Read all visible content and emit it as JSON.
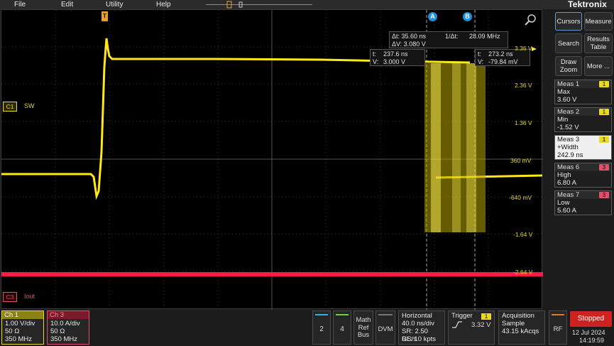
{
  "menu": {
    "items": [
      "File",
      "Edit",
      "Utility",
      "Help"
    ],
    "brand": "Tektronix"
  },
  "right_panel": {
    "buttons": [
      "Cursors",
      "Measure",
      "Search",
      "Results Table",
      "Draw Zoom",
      "More ..."
    ]
  },
  "measurements": [
    {
      "title": "Meas 1",
      "badge": "1",
      "badge_color": "#e8d82a",
      "lines": [
        "Max",
        "3.60 V"
      ],
      "active": false
    },
    {
      "title": "Meas 2",
      "badge": "1",
      "badge_color": "#e8d82a",
      "lines": [
        "Min",
        "-1.52 V"
      ],
      "active": false
    },
    {
      "title": "Meas 3",
      "badge": "1",
      "badge_color": "#e8d82a",
      "lines": [
        "+Width",
        "242.9 ns"
      ],
      "active": true
    },
    {
      "title": "Meas 6",
      "badge": "3",
      "badge_color": "#e0506a",
      "lines": [
        "High",
        "6.80 A"
      ],
      "active": false
    },
    {
      "title": "Meas 7",
      "badge": "3",
      "badge_color": "#e0506a",
      "lines": [
        "Low",
        "5.60 A"
      ],
      "active": false
    }
  ],
  "screen": {
    "trigger_marker": "T",
    "cursor_a_label": "A",
    "cursor_b_label": "B",
    "delta_readout": {
      "dt": "Δt: 35.60 ns",
      "inv_dt": "1/Δt:",
      "inv_dt_val": "28.09 MHz",
      "dv": "ΔV: 3.080 V"
    },
    "cursor_a_readout": {
      "t": "t:",
      "t_val": "237.6 ns",
      "v": "V:",
      "v_val": "3.000 V"
    },
    "cursor_b_readout": {
      "t": "t:",
      "t_val": "273.2 ns",
      "v": "V:",
      "v_val": "-79.84 mV"
    },
    "level_labels": [
      "3.36 V",
      "2.36 V",
      "1.36 V",
      "360 mV",
      "-640 mV",
      "-1.64 V",
      "-2.64 V"
    ],
    "ch1_tag": "C1",
    "ch1_name": "SW",
    "ch3_tag": "C3",
    "ch3_name": "Iout"
  },
  "bottom": {
    "ch1": {
      "title": "Ch 1",
      "lines": [
        "1.00 V/div",
        "50 Ω",
        "350 MHz"
      ],
      "color": "#e8d82a"
    },
    "ch3": {
      "title": "Ch 3",
      "lines": [
        "10.0 A/div",
        "50 Ω",
        "350 MHz"
      ],
      "color": "#e0506a"
    },
    "ch2": "2",
    "ch4": "4",
    "math_ref_bus": [
      "Math",
      "Ref",
      "Bus"
    ],
    "dvm": "DVM",
    "horizontal": {
      "title": "Horizontal",
      "lines": [
        "40.0 ns/div",
        "SR: 2.50 GS/s",
        "RL: 10 kpts"
      ]
    },
    "trigger": {
      "title": "Trigger",
      "badge": "1",
      "level": "3.32 V"
    },
    "acquisition": {
      "title": "Acquisition",
      "lines": [
        "Sample",
        "43.15 kAcqs"
      ]
    },
    "rf": "RF",
    "run_state": "Stopped",
    "date": "12 Jul 2024",
    "time": "14:19:59"
  }
}
